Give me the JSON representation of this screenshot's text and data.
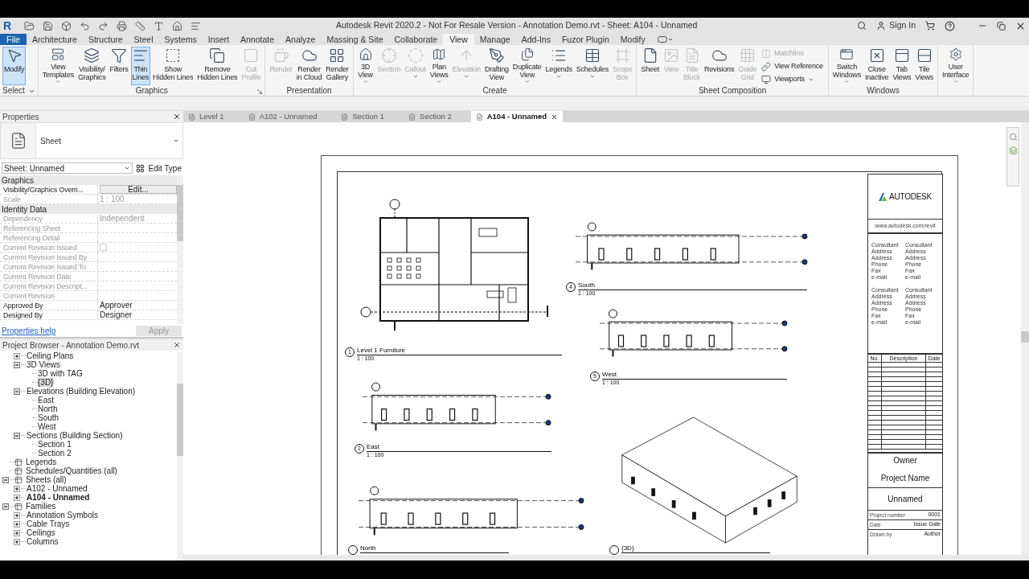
{
  "window": {
    "logo": "R",
    "title": "Autodesk Revit 2020.2 - Not For Resale Version - Annotation Demo.rvt - Sheet: A104 - Unnamed",
    "sign_in": "Sign In"
  },
  "menu_tabs": [
    {
      "label": "File",
      "kind": "file",
      "selected": false
    },
    {
      "label": "Architecture",
      "kind": "tab",
      "selected": false
    },
    {
      "label": "Structure",
      "kind": "tab",
      "selected": false
    },
    {
      "label": "Steel",
      "kind": "tab",
      "selected": false
    },
    {
      "label": "Systems",
      "kind": "tab",
      "selected": false
    },
    {
      "label": "Insert",
      "kind": "tab",
      "selected": false
    },
    {
      "label": "Annotate",
      "kind": "tab",
      "selected": false
    },
    {
      "label": "Analyze",
      "kind": "tab",
      "selected": false
    },
    {
      "label": "Massing & Site",
      "kind": "tab",
      "selected": false
    },
    {
      "label": "Collaborate",
      "kind": "tab",
      "selected": false
    },
    {
      "label": "View",
      "kind": "tab",
      "selected": true
    },
    {
      "label": "Manage",
      "kind": "tab",
      "selected": false
    },
    {
      "label": "Add-Ins",
      "kind": "tab",
      "selected": false
    },
    {
      "label": "Fuzor Plugin",
      "kind": "tab",
      "selected": false
    },
    {
      "label": "Modify",
      "kind": "tab",
      "selected": false
    }
  ],
  "ribbon": [
    {
      "title": "Select",
      "dropdown": true,
      "tools": [
        {
          "label": "Modify",
          "kind": "large",
          "selected": true,
          "disabled": false
        }
      ]
    },
    {
      "title": "Graphics",
      "launcher": true,
      "tools": [
        {
          "label": "View\nTemplates",
          "kind": "large",
          "selected": false,
          "disabled": false,
          "dropdown": true
        },
        {
          "label": "Visibility/\nGraphics",
          "kind": "large",
          "selected": false,
          "disabled": false
        },
        {
          "label": "Filters",
          "kind": "large",
          "selected": false,
          "disabled": false
        },
        {
          "label": "Thin\nLines",
          "kind": "large",
          "selected": true,
          "disabled": false
        },
        {
          "label": "Show\nHidden Lines",
          "kind": "large",
          "selected": false,
          "disabled": false
        },
        {
          "label": "Remove\nHidden Lines",
          "kind": "large",
          "selected": false,
          "disabled": false
        },
        {
          "label": "Cut\nProfile",
          "kind": "large",
          "selected": false,
          "disabled": true
        }
      ]
    },
    {
      "title": "Presentation",
      "tools": [
        {
          "label": "Render",
          "kind": "large",
          "selected": false,
          "disabled": true
        },
        {
          "label": "Render\nin Cloud",
          "kind": "large",
          "selected": false,
          "disabled": false
        },
        {
          "label": "Render\nGallery",
          "kind": "large",
          "selected": false,
          "disabled": false
        }
      ]
    },
    {
      "title": "Create",
      "tools": [
        {
          "label": "3D\nView",
          "kind": "large",
          "selected": false,
          "disabled": false,
          "dropdown": true
        },
        {
          "label": "Section",
          "kind": "large",
          "selected": false,
          "disabled": true
        },
        {
          "label": "Callout",
          "kind": "large",
          "selected": false,
          "disabled": true,
          "dropdown": true
        },
        {
          "label": "Plan\nViews",
          "kind": "large",
          "selected": false,
          "disabled": false,
          "dropdown": true
        },
        {
          "label": "Elevation",
          "kind": "large",
          "selected": false,
          "disabled": true,
          "dropdown": true
        },
        {
          "label": "Drafting\nView",
          "kind": "large",
          "selected": false,
          "disabled": false
        },
        {
          "label": "Duplicate\nView",
          "kind": "large",
          "selected": false,
          "disabled": false,
          "dropdown": true
        },
        {
          "label": "Legends",
          "kind": "large",
          "selected": false,
          "disabled": false,
          "dropdown": true
        },
        {
          "label": "Schedules",
          "kind": "large",
          "selected": false,
          "disabled": false,
          "dropdown": true
        },
        {
          "label": "Scope\nBox",
          "kind": "large",
          "selected": false,
          "disabled": true
        }
      ]
    },
    {
      "title": "Sheet Composition",
      "tools": [
        {
          "label": "Sheet",
          "kind": "large",
          "selected": false,
          "disabled": false
        },
        {
          "label": "View",
          "kind": "large",
          "selected": false,
          "disabled": true
        },
        {
          "label": "Title\nBlock",
          "kind": "large",
          "selected": false,
          "disabled": true
        },
        {
          "label": "Revisions",
          "kind": "large",
          "selected": false,
          "disabled": false
        },
        {
          "label": "Guide\nGrid",
          "kind": "large",
          "selected": false,
          "disabled": true
        },
        {
          "label": "Matchline",
          "kind": "small",
          "selected": false,
          "disabled": true
        },
        {
          "label": "View Reference",
          "kind": "small",
          "selected": false,
          "disabled": false
        },
        {
          "label": "Viewports",
          "kind": "small",
          "selected": false,
          "disabled": false,
          "dropdown": true
        }
      ]
    },
    {
      "title": "Windows",
      "tools": [
        {
          "label": "Switch\nWindows",
          "kind": "large",
          "selected": false,
          "disabled": false,
          "dropdown": true
        },
        {
          "label": "Close\nInactive",
          "kind": "large",
          "selected": false,
          "disabled": false
        },
        {
          "label": "Tab\nViews",
          "kind": "large",
          "selected": false,
          "disabled": false
        },
        {
          "label": "Tile\nViews",
          "kind": "large",
          "selected": false,
          "disabled": false
        }
      ]
    },
    {
      "tools": [
        {
          "label": "User\nInterface",
          "kind": "large",
          "selected": false,
          "disabled": false,
          "dropdown": true
        }
      ]
    }
  ],
  "properties": {
    "title": "Properties",
    "type_name": "Sheet",
    "instance": "Sheet: Unnamed",
    "edit_type": "Edit Type",
    "groups": [
      {
        "title": "Graphics",
        "rows": [
          {
            "name": "Visibility/Graphics Overri...",
            "value": "Edit...",
            "kind": "button",
            "disabled": false
          },
          {
            "name": "Scale",
            "value": "1 : 100",
            "kind": "text",
            "disabled": true
          }
        ]
      },
      {
        "title": "Identity Data",
        "rows": [
          {
            "name": "Dependency",
            "value": "Independent",
            "kind": "text",
            "disabled": true
          },
          {
            "name": "Referencing Sheet",
            "kind": "text",
            "disabled": true
          },
          {
            "name": "Referencing Detail",
            "kind": "text",
            "disabled": true
          },
          {
            "name": "Current Revision Issued",
            "kind": "checkbox",
            "checked": false,
            "disabled": true
          },
          {
            "name": "Current Revision Issued By",
            "kind": "text",
            "disabled": true
          },
          {
            "name": "Current Revision Issued To",
            "kind": "text",
            "disabled": true
          },
          {
            "name": "Current Revision Date",
            "kind": "text",
            "disabled": true
          },
          {
            "name": "Current Revision Descript...",
            "kind": "text",
            "disabled": true
          },
          {
            "name": "Current Revision",
            "kind": "text",
            "disabled": true
          },
          {
            "name": "Approved By",
            "value": "Approver",
            "kind": "text",
            "disabled": false
          },
          {
            "name": "Designed By",
            "value": "Designer",
            "kind": "text",
            "disabled": false
          }
        ]
      }
    ],
    "help_link": "Properties help",
    "apply": "Apply"
  },
  "browser": {
    "title": "Project Browser - Annotation Demo.rvt",
    "items": [
      {
        "children": [
          {
            "label": "Ceiling Plans",
            "expanded": false,
            "selected": false
          },
          {
            "label": "3D Views",
            "expanded": true,
            "selected": false,
            "children": [
              {
                "label": "3D with TAG",
                "selected": false
              },
              {
                "label": "{3D}",
                "selected": true
              }
            ]
          },
          {
            "label": "Elevations (Building Elevation)",
            "expanded": true,
            "selected": false,
            "children": [
              {
                "label": "East",
                "selected": false
              },
              {
                "label": "North",
                "selected": false
              },
              {
                "label": "South",
                "selected": false
              },
              {
                "label": "West",
                "selected": false
              }
            ]
          },
          {
            "label": "Sections (Building Section)",
            "expanded": true,
            "selected": false,
            "children": [
              {
                "label": "Section 1",
                "selected": false
              },
              {
                "label": "Section 2",
                "selected": false
              }
            ]
          }
        ]
      },
      {
        "label": "Legends",
        "selected": false
      },
      {
        "label": "Schedules/Quantities (all)",
        "selected": false
      },
      {
        "label": "Sheets (all)",
        "expanded": true,
        "selected": false,
        "children": [
          {
            "label": "A102 - Unnamed",
            "expanded": false,
            "selected": false,
            "active": false
          },
          {
            "label": "A104 - Unnamed",
            "expanded": false,
            "selected": false,
            "active": true
          }
        ]
      },
      {
        "label": "Families",
        "expanded": true,
        "selected": false,
        "children": [
          {
            "label": "Annotation Symbols",
            "expanded": false,
            "selected": false
          },
          {
            "label": "Cable Trays",
            "expanded": false,
            "selected": false
          },
          {
            "label": "Ceilings",
            "expanded": false,
            "selected": false
          },
          {
            "label": "Columns",
            "expanded": false,
            "selected": false
          }
        ]
      }
    ]
  },
  "view_tabs": [
    {
      "label": "Level 1",
      "selected": false
    },
    {
      "label": "A102 - Unnamed",
      "selected": false
    },
    {
      "label": "Section 1",
      "selected": false
    },
    {
      "label": "Section 2",
      "selected": false
    },
    {
      "label": "A104 - Unnamed",
      "selected": true
    }
  ],
  "views": [
    {
      "kind": "plan",
      "number": "1",
      "title": "Level 1 Furniture",
      "scale": "1 : 100"
    },
    {
      "kind": "elevation",
      "number": "4",
      "title": "South",
      "scale": "1 : 100"
    },
    {
      "kind": "elevation",
      "number": "5",
      "title": "West",
      "scale": "1 : 100"
    },
    {
      "kind": "elevation",
      "number": "2",
      "title": "East",
      "scale": "1 : 100"
    },
    {
      "kind": "elevation",
      "title": "North"
    },
    {
      "kind": "axonometric",
      "title": "{3D}"
    }
  ],
  "title_block": {
    "logo": "AUTODESK",
    "website": "www.autodesk.com/revit",
    "consultants": [
      {
        "lines": [
          "Consultant",
          "Address",
          "Address",
          "Phone",
          "Fax",
          "e-mail"
        ]
      },
      {
        "lines": [
          "Consultant",
          "Address",
          "Address",
          "Phone",
          "Fax",
          "e-mail"
        ]
      },
      {
        "lines": [
          "Consultant",
          "Address",
          "Address",
          "Phone",
          "Fax",
          "e-mail"
        ]
      },
      {
        "lines": [
          "Consultant",
          "Address",
          "Address",
          "Phone",
          "Fax",
          "e-mail"
        ]
      }
    ],
    "revision_columns": [
      "No.",
      "Description",
      "Date"
    ],
    "owner": "Owner",
    "project_name": "Project Name",
    "sheet_name": "Unnamed",
    "fields": [
      {
        "label": "Project number",
        "value": "0001"
      },
      {
        "label": "Date",
        "value": "Issue Date"
      },
      {
        "label": "Drawn by",
        "value": "Author"
      }
    ]
  }
}
